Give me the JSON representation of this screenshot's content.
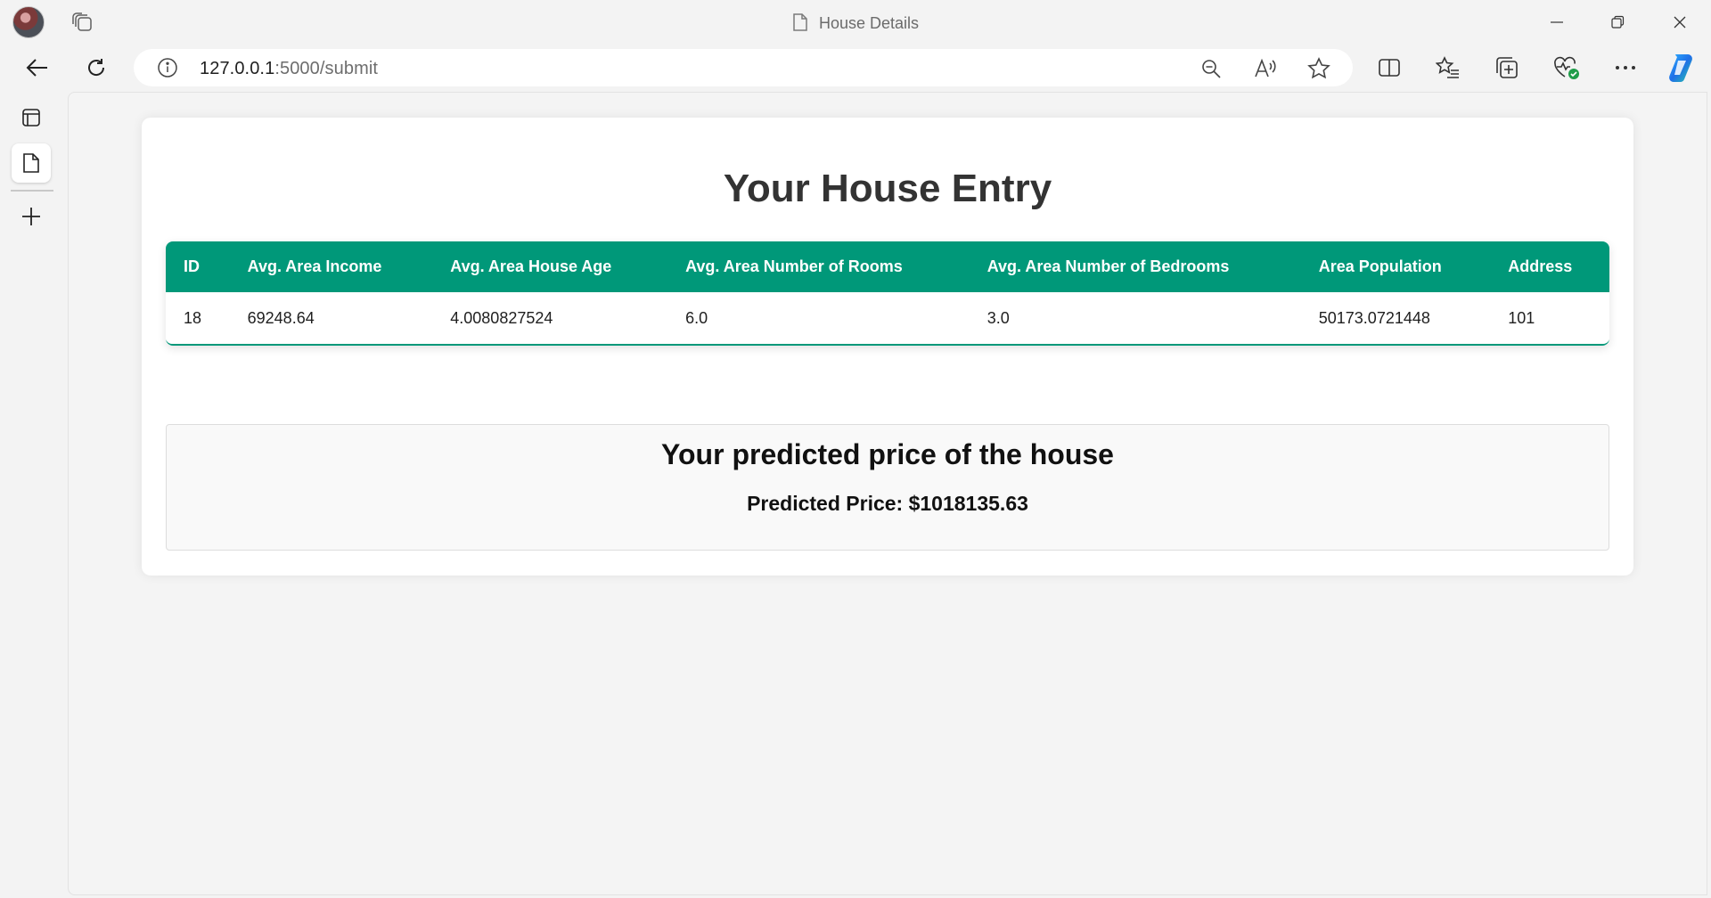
{
  "window": {
    "title": "House Details",
    "controls": [
      "minimize",
      "restore",
      "close"
    ]
  },
  "toolbar": {
    "url_host": "127.0.0.1",
    "url_rest": ":5000/submit"
  },
  "page": {
    "heading": "Your House Entry",
    "table": {
      "header_color": "#009879",
      "columns": [
        "ID",
        "Avg. Area Income",
        "Avg. Area House Age",
        "Avg. Area Number of Rooms",
        "Avg. Area Number of Bedrooms",
        "Area Population",
        "Address"
      ],
      "rows": [
        [
          "18",
          "69248.64",
          "4.0080827524",
          "6.0",
          "3.0",
          "50173.0721448",
          "101"
        ]
      ]
    },
    "prediction": {
      "title": "Your predicted price of the house",
      "price_text": "Predicted Price: $1018135.63"
    }
  }
}
